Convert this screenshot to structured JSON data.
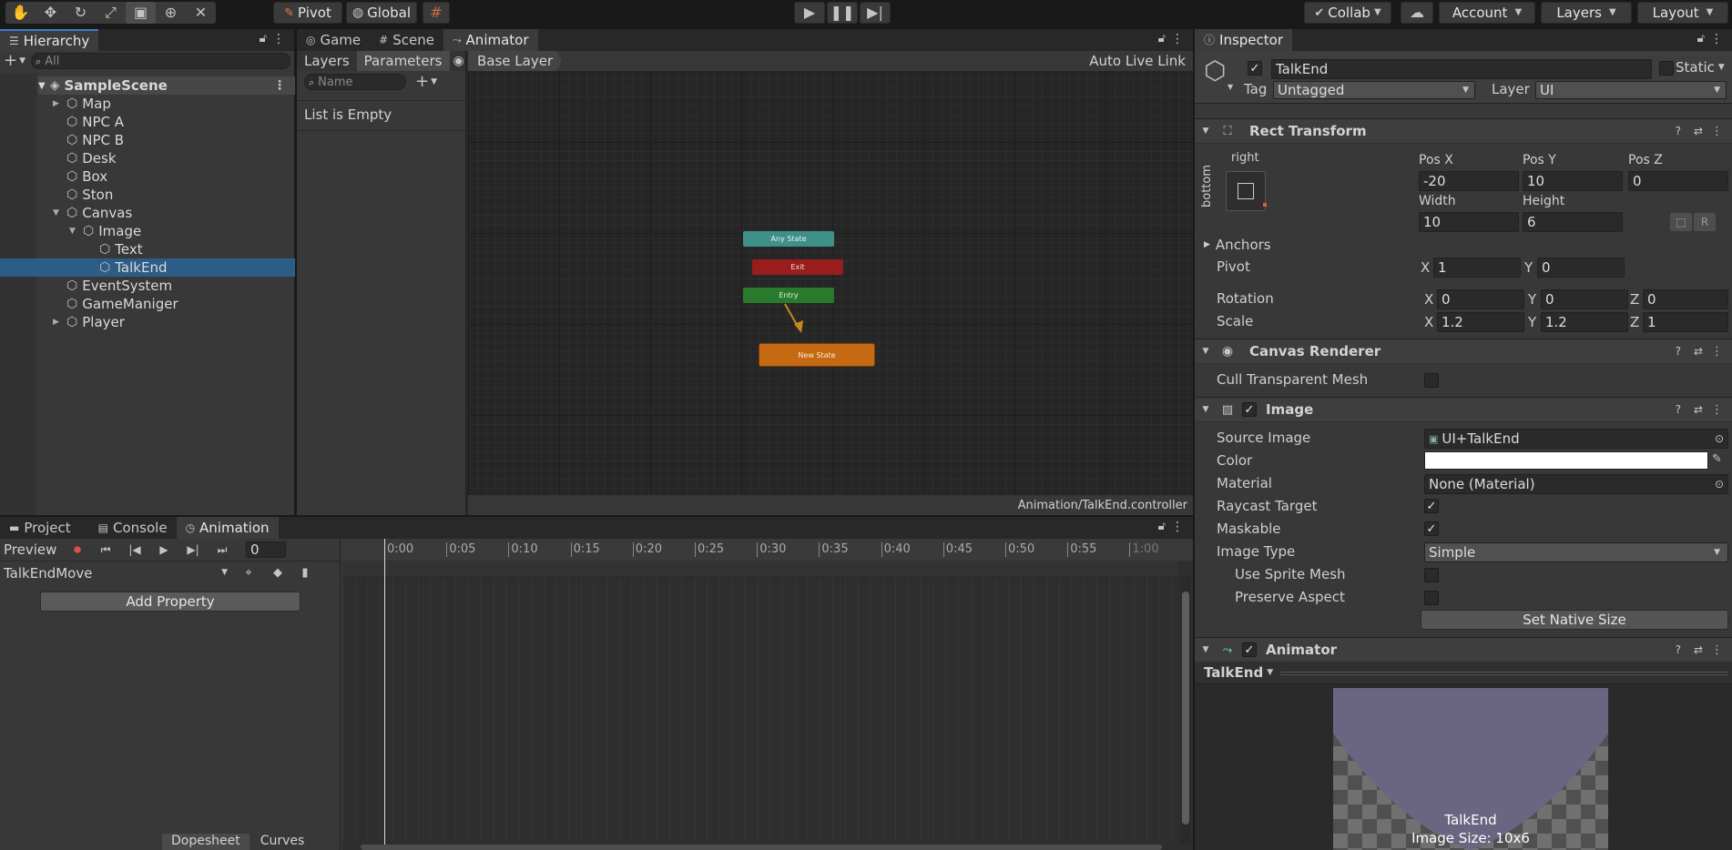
{
  "toolbar": {
    "pivot": "Pivot",
    "global": "Global",
    "collab": "Collab",
    "account": "Account",
    "layers": "Layers",
    "layout": "Layout"
  },
  "hierarchy": {
    "tab": "Hierarchy",
    "search_placeholder": "All",
    "scene": "SampleScene",
    "items": [
      "Map",
      "NPC A",
      "NPC B",
      "Desk",
      "Box",
      "Ston",
      "Canvas",
      "Image",
      "Text",
      "TalkEnd",
      "EventSystem",
      "GameManiger",
      "Player"
    ]
  },
  "animator": {
    "tabs": [
      "Game",
      "Scene",
      "Animator"
    ],
    "sub_tabs": [
      "Layers",
      "Parameters"
    ],
    "name_placeholder": "Name",
    "empty": "List is Empty",
    "base_layer": "Base Layer",
    "auto_live_link": "Auto Live Link",
    "states": {
      "any": "Any State",
      "exit": "Exit",
      "entry": "Entry",
      "new": "New State"
    },
    "footer_path": "Animation/TalkEnd.controller"
  },
  "animation": {
    "tabs": [
      "Project",
      "Console",
      "Animation"
    ],
    "preview": "Preview",
    "frame": "0",
    "clip": "TalkEndMove",
    "add_property": "Add Property",
    "ticks": [
      "0:00",
      "0:05",
      "0:10",
      "0:15",
      "0:20",
      "0:25",
      "0:30",
      "0:35",
      "0:40",
      "0:45",
      "0:50",
      "0:55",
      "1:00"
    ],
    "bottom_tabs": [
      "Dopesheet",
      "Curves"
    ]
  },
  "inspector": {
    "tab": "Inspector",
    "object_name": "TalkEnd",
    "static": "Static",
    "tag_label": "Tag",
    "tag_value": "Untagged",
    "layer_label": "Layer",
    "layer_value": "UI",
    "rect": {
      "title": "Rect Transform",
      "anchor_h": "right",
      "anchor_v": "bottom",
      "pos_x_label": "Pos X",
      "pos_y_label": "Pos Y",
      "pos_z_label": "Pos Z",
      "pos_x": "-20",
      "pos_y": "10",
      "pos_z": "0",
      "width_label": "Width",
      "height_label": "Height",
      "width": "10",
      "height": "6",
      "r_label": "R",
      "anchors": "Anchors",
      "pivot": "Pivot",
      "pivot_x": "1",
      "pivot_y": "0",
      "rotation": "Rotation",
      "rot_x": "0",
      "rot_y": "0",
      "rot_z": "0",
      "scale": "Scale",
      "scale_x": "1.2",
      "scale_y": "1.2",
      "scale_z": "1",
      "x": "X",
      "y": "Y",
      "z": "Z"
    },
    "canvas_renderer": {
      "title": "Canvas Renderer",
      "cull": "Cull Transparent Mesh"
    },
    "image": {
      "title": "Image",
      "source_image_label": "Source Image",
      "source_image": "UI+TalkEnd",
      "color_label": "Color",
      "material_label": "Material",
      "material": "None (Material)",
      "raycast": "Raycast Target",
      "maskable": "Maskable",
      "image_type_label": "Image Type",
      "image_type": "Simple",
      "use_sprite_mesh": "Use Sprite Mesh",
      "preserve_aspect": "Preserve Aspect",
      "set_native_size": "Set Native Size"
    },
    "animator_comp": {
      "title": "Animator",
      "dropdown": "TalkEnd"
    },
    "preview": {
      "name": "TalkEnd",
      "size": "Image Size: 10x6"
    }
  },
  "colors": {
    "accent": "#2c5d87",
    "any_state": "#3f8f8b",
    "exit": "#9a1d1d",
    "entry": "#2a7a2e",
    "new_state": "#c56a12",
    "preview_top": "#6a6580"
  }
}
